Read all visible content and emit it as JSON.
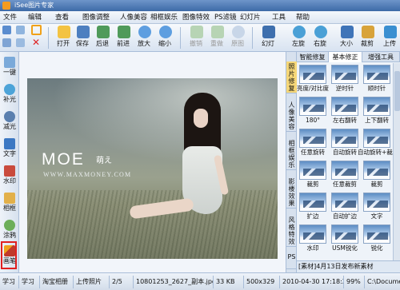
{
  "app": {
    "title": "iSee图片专家"
  },
  "menu": [
    "文件",
    "编辑",
    "查看",
    "图像调整",
    "人像美容",
    "相框娱乐",
    "图像特效",
    "PS滤镜",
    "幻灯片",
    "工具",
    "帮助"
  ],
  "toolbar": {
    "open": "打开",
    "save": "保存",
    "back": "后退",
    "forward": "前进",
    "zoom_in": "放大",
    "zoom_out": "缩小",
    "undo": "撤销",
    "redo": "重做",
    "original": "原图",
    "slideshow": "幻灯",
    "rotate_left": "左旋",
    "rotate_right": "右旋",
    "resize": "大小",
    "crop": "裁剪",
    "upload": "上传"
  },
  "left_tools": [
    "一键",
    "补光",
    "减光",
    "文字",
    "水印",
    "相框",
    "涂鸦",
    "画笔"
  ],
  "watermark": {
    "title": "MOE",
    "cn": "萌え",
    "url": "WWW.MAXMONEY.COM"
  },
  "right_vtabs": [
    "照片修复",
    "人像美容",
    "相框娱乐",
    "影楼效果",
    "风格特效",
    "PS"
  ],
  "right_tabs": [
    "智能修复",
    "基本修正",
    "增强工具"
  ],
  "effects": [
    "亮度/对比度",
    "逆时针",
    "顺时针",
    "180°",
    "左右翻转",
    "上下翻转",
    "任意旋转",
    "自动旋转",
    "自动旋转+裁剪",
    "裁剪",
    "任意裁剪",
    "裁剪",
    "扩边",
    "自动扩边",
    "文字",
    "水印",
    "USM锐化",
    "锐化"
  ],
  "news": "[素材]4月13日发布新素材",
  "status": {
    "learn": "学习",
    "study": "学习",
    "taobao": "淘宝相册",
    "upload": "上传照片",
    "page": "2/5",
    "filename": "10801253_2627_副本.jpg",
    "size": "33 KB",
    "dims": "500x329",
    "datetime": "2010-04-30 17:18:26",
    "zoom": "99%",
    "path": "C:\\Documents"
  },
  "colors": {
    "accent": "#3d6aa7",
    "highlight": "#f6d778",
    "selection": "#e02020"
  }
}
